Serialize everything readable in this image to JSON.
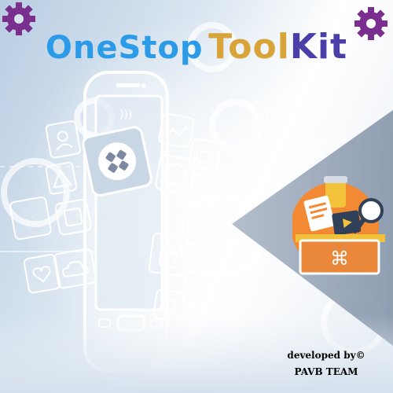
{
  "title": {
    "part_one": "OneStop",
    "part_two": "ToolKit",
    "display": [
      "One",
      "Stop",
      "Tool",
      "Kit"
    ]
  },
  "credit": {
    "line1": "developed by©",
    "line2": "PAVB TEAM"
  },
  "toolbox": {
    "command_glyph": "⌘"
  },
  "colors": {
    "title_blue": "#2b9be8",
    "title_gold": "#d8a43a",
    "title_purple": "#4a3ea8",
    "gear_purple": "#7a2f8e",
    "toolbox_circle": "#f28a33",
    "toolbox_body": "#e9873a",
    "background_blue": "#b9cde2"
  },
  "icons": [
    "settings-gear-icon",
    "grid-apps-icon",
    "cloud-icon",
    "chart-icon",
    "user-icon",
    "warning-icon",
    "briefcase-icon",
    "cart-icon",
    "lock-icon",
    "dice-icon",
    "money-icon",
    "heart-icon",
    "tools-icon",
    "globe-icon",
    "magnifier-icon",
    "clipboard-icon",
    "video-icon"
  ]
}
